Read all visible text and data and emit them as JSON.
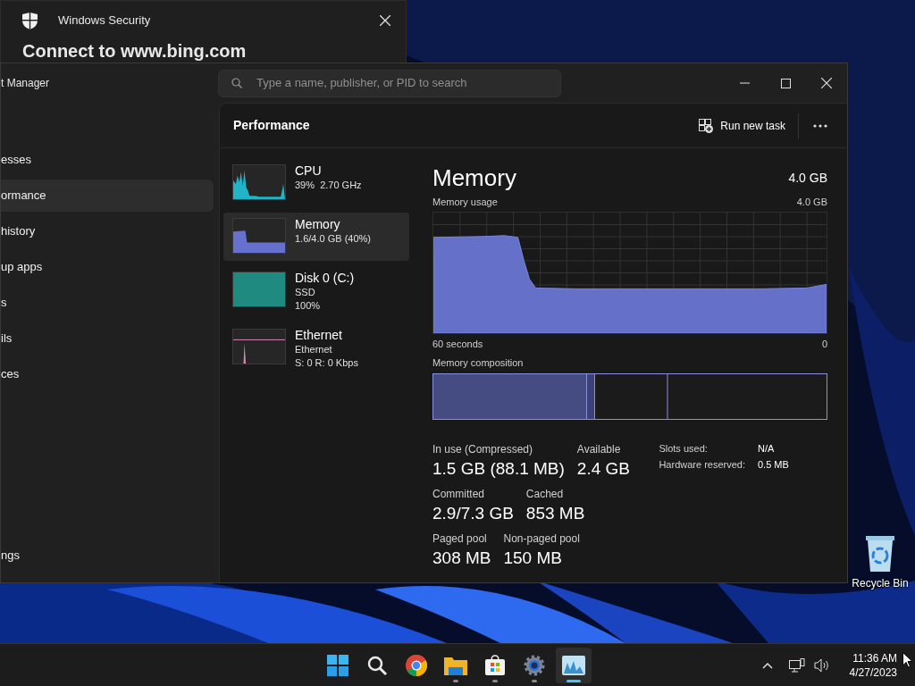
{
  "security_window": {
    "title": "Windows Security",
    "heading": "Connect to www.bing.com"
  },
  "task_manager": {
    "title": "t Manager",
    "search": {
      "placeholder": "Type a name, publisher, or PID to search"
    },
    "nav": [
      {
        "label": "esses",
        "selected": false
      },
      {
        "label": "ormance",
        "selected": true
      },
      {
        "label": "history",
        "selected": false
      },
      {
        "label": "up apps",
        "selected": false
      },
      {
        "label": "s",
        "selected": false
      },
      {
        "label": "ils",
        "selected": false
      },
      {
        "label": "ces",
        "selected": false
      }
    ],
    "settings": "ngs",
    "page_title": "Performance",
    "run_new_task": "Run new task",
    "resources": [
      {
        "kind": "cpu",
        "name": "CPU",
        "details": [
          "39%  2.70 GHz"
        ],
        "selected": false
      },
      {
        "kind": "memory",
        "name": "Memory",
        "details": [
          "1.6/4.0 GB (40%)"
        ],
        "selected": true
      },
      {
        "kind": "disk",
        "name": "Disk 0 (C:)",
        "details": [
          "SSD",
          "100%"
        ],
        "selected": false
      },
      {
        "kind": "ethernet",
        "name": "Ethernet",
        "details": [
          "Ethernet",
          "S: 0 R: 0 Kbps"
        ],
        "selected": false
      }
    ],
    "detail": {
      "title": "Memory",
      "total": "4.0 GB",
      "usage_label": "Memory usage",
      "usage_max": "4.0 GB",
      "time_span": "60 seconds",
      "time_end": "0",
      "composition_label": "Memory composition",
      "stats": [
        [
          {
            "label": "In use (Compressed)",
            "value": "1.5 GB (88.1 MB)"
          },
          {
            "label": "Available",
            "value": "2.4 GB"
          }
        ],
        [
          {
            "label": "Committed",
            "value": "2.9/7.3 GB"
          },
          {
            "label": "Cached",
            "value": "853 MB"
          }
        ],
        [
          {
            "label": "Paged pool",
            "value": "308 MB"
          },
          {
            "label": "Non-paged pool",
            "value": "150 MB"
          }
        ]
      ],
      "facts": [
        {
          "label": "Slots used:",
          "value": "N/A"
        },
        {
          "label": "Hardware reserved:",
          "value": "0.5 MB"
        }
      ]
    }
  },
  "desktop": {
    "recycle_bin": "Recycle Bin"
  },
  "taskbar": {
    "apps": [
      {
        "kind": "start",
        "running": false,
        "selected": false
      },
      {
        "kind": "search",
        "running": false,
        "selected": false
      },
      {
        "kind": "chrome",
        "running": false,
        "selected": false
      },
      {
        "kind": "explorer",
        "running": true,
        "selected": false
      },
      {
        "kind": "store",
        "running": true,
        "selected": false
      },
      {
        "kind": "settings",
        "running": true,
        "selected": false
      },
      {
        "kind": "taskmanager",
        "running": true,
        "selected": true
      }
    ],
    "time": "11:36 AM",
    "date": "4/27/2023"
  }
}
